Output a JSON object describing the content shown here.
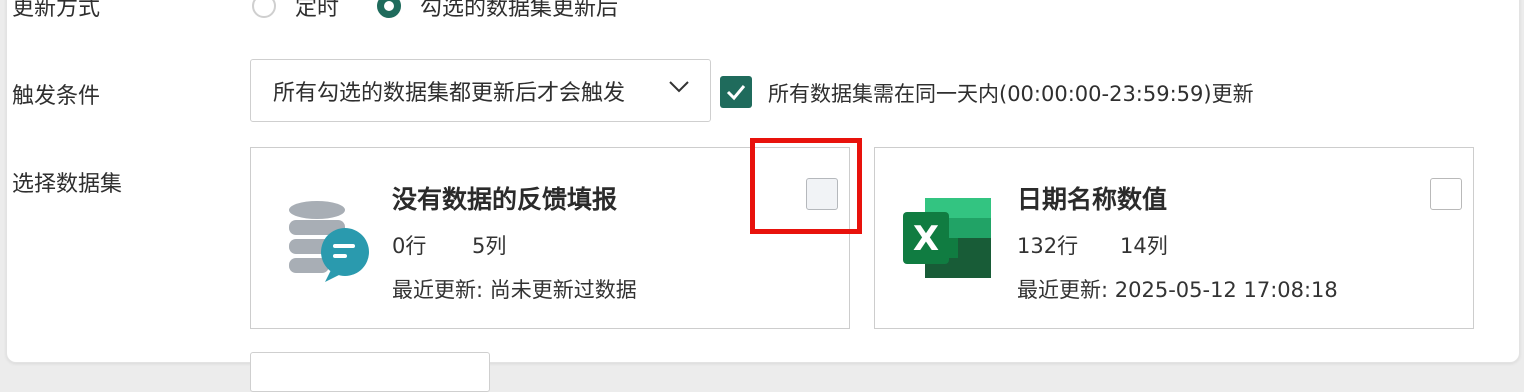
{
  "row_update_mode": {
    "label": "更新方式",
    "options": [
      {
        "label": "定时",
        "selected": false
      },
      {
        "label": "勾选的数据集更新后",
        "selected": true
      }
    ]
  },
  "row_trigger": {
    "label": "触发条件",
    "dropdown_value": "所有勾选的数据集都更新后才会触发",
    "same_day_checkbox": {
      "checked": true,
      "label": "所有数据集需在同一天内(00:00:00-23:59:59)更新"
    }
  },
  "row_datasets": {
    "label": "选择数据集",
    "cards": [
      {
        "icon": "database-feedback-icon",
        "title": "没有数据的反馈填报",
        "rows": "0行",
        "cols": "5列",
        "updated": "最近更新: 尚未更新过数据",
        "checked": false
      },
      {
        "icon": "excel-icon",
        "title": "日期名称数值",
        "rows": "132行",
        "cols": "14列",
        "updated": "最近更新: 2025-05-12 17:08:18",
        "checked": false
      }
    ]
  },
  "colors": {
    "accent": "#1f6b5c",
    "highlight": "#e8120c",
    "excel_green": "#1e7145"
  }
}
